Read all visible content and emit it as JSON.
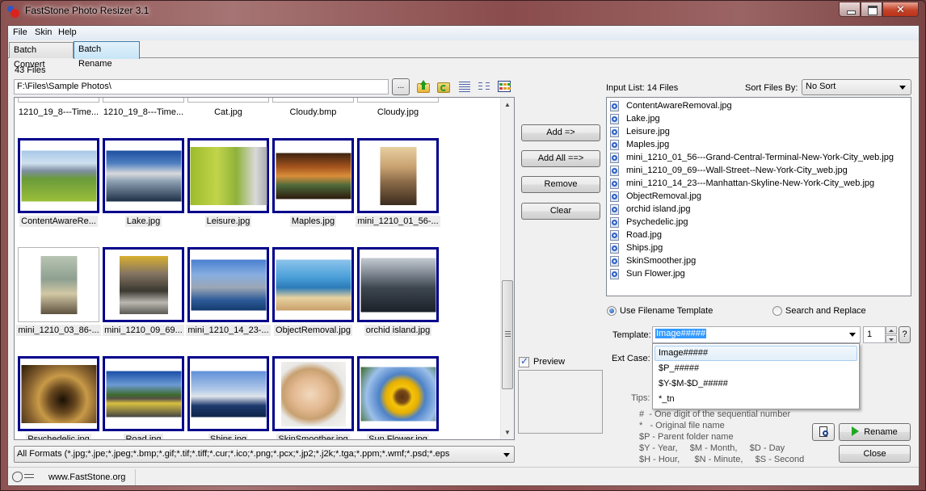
{
  "window": {
    "title": "FastStone Photo Resizer 3.1",
    "controls": {
      "minimize": "minimize",
      "maximize": "maximize",
      "close": "✕"
    }
  },
  "menu": [
    "File",
    "Skin",
    "Help"
  ],
  "tabs": [
    {
      "label": "Batch Convert",
      "active": false
    },
    {
      "label": "Batch Rename",
      "active": true
    }
  ],
  "browser": {
    "files_count": "43 Files",
    "path": "F:\\Files\\Sample Photos\\",
    "browse_label": "...",
    "toolbar_icons": [
      "folder-up-icon",
      "folder-refresh-icon",
      "details-view-icon",
      "list-view-icon",
      "thumbnail-view-icon"
    ],
    "partial_top_labels": [
      "1210_19_8---Time...",
      "1210_19_8---Time...",
      "Cat.jpg",
      "Cloudy.bmp",
      "Cloudy.jpg"
    ],
    "thumbnails": [
      {
        "label": "ContentAwareRe...",
        "selected": true
      },
      {
        "label": "Lake.jpg",
        "selected": true
      },
      {
        "label": "Leisure.jpg",
        "selected": true
      },
      {
        "label": "Maples.jpg",
        "selected": true
      },
      {
        "label": "mini_1210_01_56-...",
        "selected": true
      },
      {
        "label": "mini_1210_03_86-...",
        "selected": false
      },
      {
        "label": "mini_1210_09_69...",
        "selected": true
      },
      {
        "label": "mini_1210_14_23-...",
        "selected": true
      },
      {
        "label": "ObjectRemoval.jpg",
        "selected": true
      },
      {
        "label": "orchid island.jpg",
        "selected": true
      },
      {
        "label": "Psychedelic.jpg",
        "selected": true
      },
      {
        "label": "Road.jpg",
        "selected": true
      },
      {
        "label": "Ships.jpg",
        "selected": true
      },
      {
        "label": "SkinSmoother.jpg",
        "selected": true
      },
      {
        "label": "Sun Flower.jpg",
        "selected": true
      }
    ],
    "format_filter": "All Formats (*.jpg;*.jpe;*.jpeg;*.bmp;*.gif;*.tif;*.tiff;*.cur;*.ico;*.png;*.pcx;*.jp2;*.j2k;*.tga;*.ppm;*.wmf;*.psd;*.eps"
  },
  "actions": {
    "add": "Add =>",
    "add_all": "Add All ==>",
    "remove": "Remove",
    "clear": "Clear",
    "preview_label": "Preview",
    "preview_checked": true
  },
  "input_list": {
    "label": "Input List:  14 Files",
    "sort_label": "Sort Files By:",
    "sort_value": "No Sort",
    "files": [
      "ContentAwareRemoval.jpg",
      "Lake.jpg",
      "Leisure.jpg",
      "Maples.jpg",
      "mini_1210_01_56---Grand-Central-Terminal-New-York-City_web.jpg",
      "mini_1210_09_69---Wall-Street--New-York-City_web.jpg",
      "mini_1210_14_23---Manhattan-Skyline-New-York-City_web.jpg",
      "ObjectRemoval.jpg",
      "orchid island.jpg",
      "Psychedelic.jpg",
      "Road.jpg",
      "Ships.jpg",
      "SkinSmoother.jpg",
      "Sun Flower.jpg"
    ]
  },
  "rename": {
    "mode_template_label": "Use Filename Template",
    "mode_search_label": "Search and Replace",
    "selected_mode": "template",
    "template_label": "Template:",
    "template_value": "Image#####",
    "start_number": "1",
    "help_label": "?",
    "ext_case_label": "Ext Case:",
    "tips_label": "Tips:",
    "template_options": [
      "Image#####",
      "$P_#####",
      "$Y-$M-$D_#####",
      "*_tn"
    ],
    "highlighted_option": 0,
    "tips": [
      "#  - One digit of the sequential number",
      "*   - Original file name",
      "$P - Parent folder name",
      "$Y - Year,     $M - Month,     $D - Day",
      "$H - Hour,      $N - Minute,     $S - Second"
    ],
    "rename_label": "Rename",
    "close_label": "Close"
  },
  "status": {
    "website": "www.FastStone.org"
  }
}
